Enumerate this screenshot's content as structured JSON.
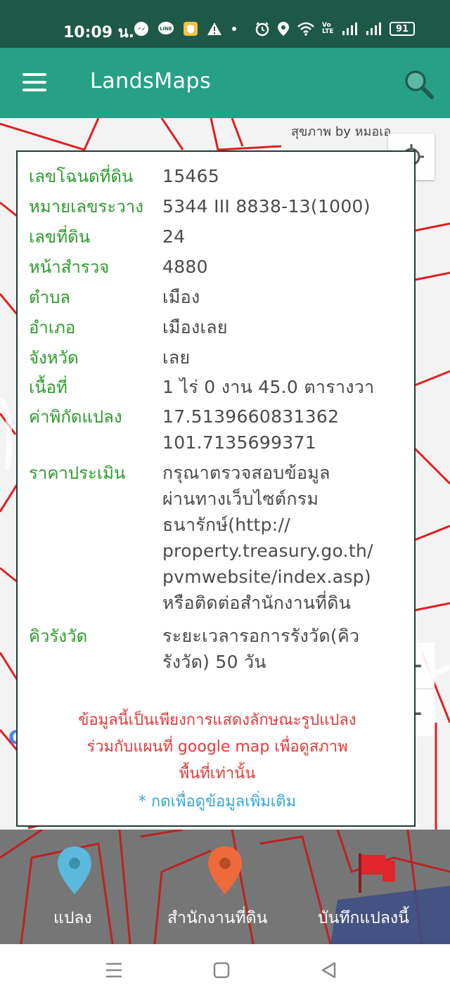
{
  "status_bar": {
    "time": "10:09 น.",
    "battery": "91",
    "network_label": "Vo LTE"
  },
  "app_bar": {
    "title": "LandsMaps"
  },
  "map": {
    "photo_credit": "สุขภาพ by หมอเอ",
    "google_logo": "Google",
    "zoom_in_label": "+",
    "zoom_out_label": "−"
  },
  "parcel_info": {
    "rows": [
      {
        "label": "เลขโฉนดที่ดิน",
        "value": "15465"
      },
      {
        "label": "หมายเลขระวาง",
        "value": "5344 III 8838-13(1000)"
      },
      {
        "label": "เลขที่ดิน",
        "value": "24"
      },
      {
        "label": "หน้าสำรวจ",
        "value": "4880"
      },
      {
        "label": "ตำบล",
        "value": "เมือง"
      },
      {
        "label": "อำเภอ",
        "value": "เมืองเลย"
      },
      {
        "label": "จังหวัด",
        "value": "เลย"
      },
      {
        "label": "เนื้อที่",
        "value": "1 ไร่ 0 งาน 45.0 ตารางวา"
      },
      {
        "label": "ค่าพิกัดแปลง",
        "value_lines": [
          "17.5139660831362",
          "101.7135699371"
        ]
      },
      {
        "label": "ราคาประเมิน",
        "value_lines": [
          "กรุณาตรวจสอบข้อมูล",
          "ผ่านทางเว็บไซต์กรม",
          "ธนารักษ์(http://",
          "property.treasury.go.th/",
          "pvmwebsite/index.asp)",
          "หรือติดต่อสำนักงานที่ดิน"
        ]
      },
      {
        "label": "คิวรังวัด",
        "value_lines": [
          "ระยะเวลารอการรังวัด(คิว",
          "รังวัด) 50 วัน"
        ]
      }
    ],
    "notice_lines": [
      "ข้อมูลนี้เป็นเพียงการแสดงลักษณะรูปแปลง",
      "ร่วมกับแผนที่ google map เพื่อดูสภาพ",
      "พื้นที่เท่านั้น"
    ],
    "more_link": "* กดเพื่อดูข้อมูลเพิ่มเติม"
  },
  "bottom_tabs": [
    {
      "label": "แปลง",
      "icon": "map-pin-blue-icon",
      "color": "#5ab9dc"
    },
    {
      "label": "สำนักงานที่ดิน",
      "icon": "map-pin-orange-icon",
      "color": "#ef6a3a"
    },
    {
      "label": "บันทึกแปลงนี้",
      "icon": "red-flag-icon",
      "color": "#e0272b"
    }
  ],
  "colors": {
    "status_bar": "#1e5847",
    "app_bar": "#27a186",
    "label_green": "#2e9b2e",
    "notice_red": "#e33a3a",
    "link_blue": "#37a7d4"
  }
}
